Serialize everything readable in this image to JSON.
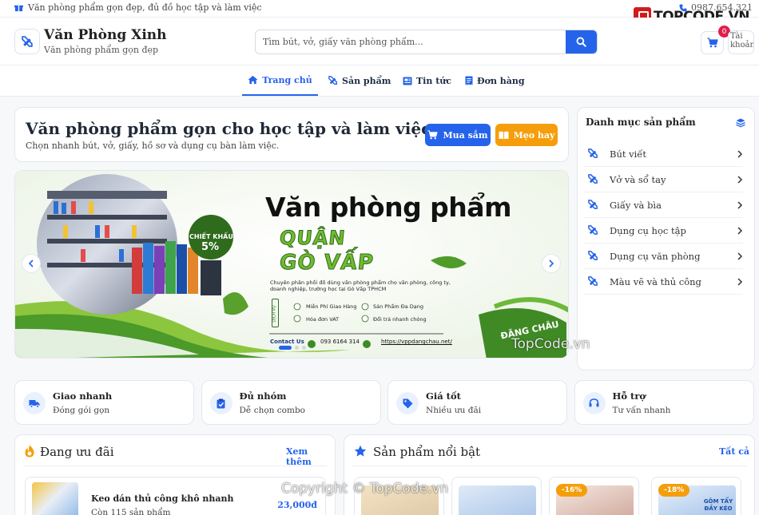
{
  "topbar": {
    "promo": "Văn phòng phẩm gọn đẹp, đủ đồ học tập và làm việc",
    "phone": "0987.654.321"
  },
  "watermark": {
    "brand": "TOPCODE.VN",
    "mid": "TopCode.vn",
    "bottom": "Copyright © TopCode.vn"
  },
  "header": {
    "site_name": "Văn Phòng Xinh",
    "tagline": "Văn phòng phẩm gọn đẹp",
    "search_placeholder": "Tìm bút, vở, giấy văn phòng phẩm...",
    "cart_count": "0",
    "account_alt": "Tài khoản"
  },
  "nav": {
    "items": [
      {
        "label": "Trang chủ",
        "icon": "home-icon"
      },
      {
        "label": "Sản phẩm",
        "icon": "tools-icon"
      },
      {
        "label": "Tin tức",
        "icon": "news-icon"
      },
      {
        "label": "Đơn hàng",
        "icon": "receipt-icon"
      }
    ]
  },
  "hero": {
    "title": "Văn phòng phẩm gọn cho học tập và làm việc",
    "subtitle": "Chọn nhanh bút, vở, giấy, hồ sơ và dụng cụ bàn làm việc.",
    "shop_label": "Mua sắm",
    "tips_label": "Mẹo hay"
  },
  "banner": {
    "title": "Văn phòng phẩm",
    "line1": "QUẬN",
    "line2": "GÒ VẤP",
    "discount_label": "CHIẾT KHẤU",
    "discount_value": "5%",
    "description": "Chuyên phân phối đồ dùng văn phòng phẩm cho văn phòng, công ty, doanh nghiệp, trường học tại Gò Vấp TPHCM",
    "service_label": "DỊCH VỤ",
    "features": [
      "Miễn Phí Giao Hàng",
      "Sản Phẩm Đa Dạng",
      "Hóa đơn VAT",
      "Đổi trả nhanh chóng"
    ],
    "contact": "Contact Us",
    "phone": "093 6164 314",
    "website": "https://vppdangchau.net/",
    "brand": "ĐĂNG CHÂU"
  },
  "categories": {
    "title": "Danh mục sản phẩm",
    "items": [
      "Bút viết",
      "Vở và sổ tay",
      "Giấy và bìa",
      "Dụng cụ học tập",
      "Dụng cụ văn phòng",
      "Màu vẽ và thủ công"
    ]
  },
  "features": [
    {
      "title": "Giao nhanh",
      "sub": "Đóng gói gọn",
      "icon": "truck-icon"
    },
    {
      "title": "Đủ nhóm",
      "sub": "Dễ chọn combo",
      "icon": "clipboard-check-icon"
    },
    {
      "title": "Giá tốt",
      "sub": "Nhiều ưu đãi",
      "icon": "tags-icon"
    },
    {
      "title": "Hỗ trợ",
      "sub": "Tư vấn nhanh",
      "icon": "headset-icon"
    }
  ],
  "deals": {
    "title": "Đang ưu đãi",
    "more": "Xem thêm",
    "item": {
      "name": "Keo dán thủ công khô nhanh",
      "price": "23,000đ",
      "stock": "Còn 115 sản phẩm"
    }
  },
  "featured": {
    "title": "Sản phẩm nổi bật",
    "all": "Tất cả",
    "discounts": [
      "",
      "",
      "-16%",
      "-18%"
    ],
    "card4_text": "GÔM TẨY ĐẦY KÉO"
  },
  "colors": {
    "primary": "#2563eb",
    "orange": "#f59e0b",
    "green": "#6fbb2e"
  }
}
